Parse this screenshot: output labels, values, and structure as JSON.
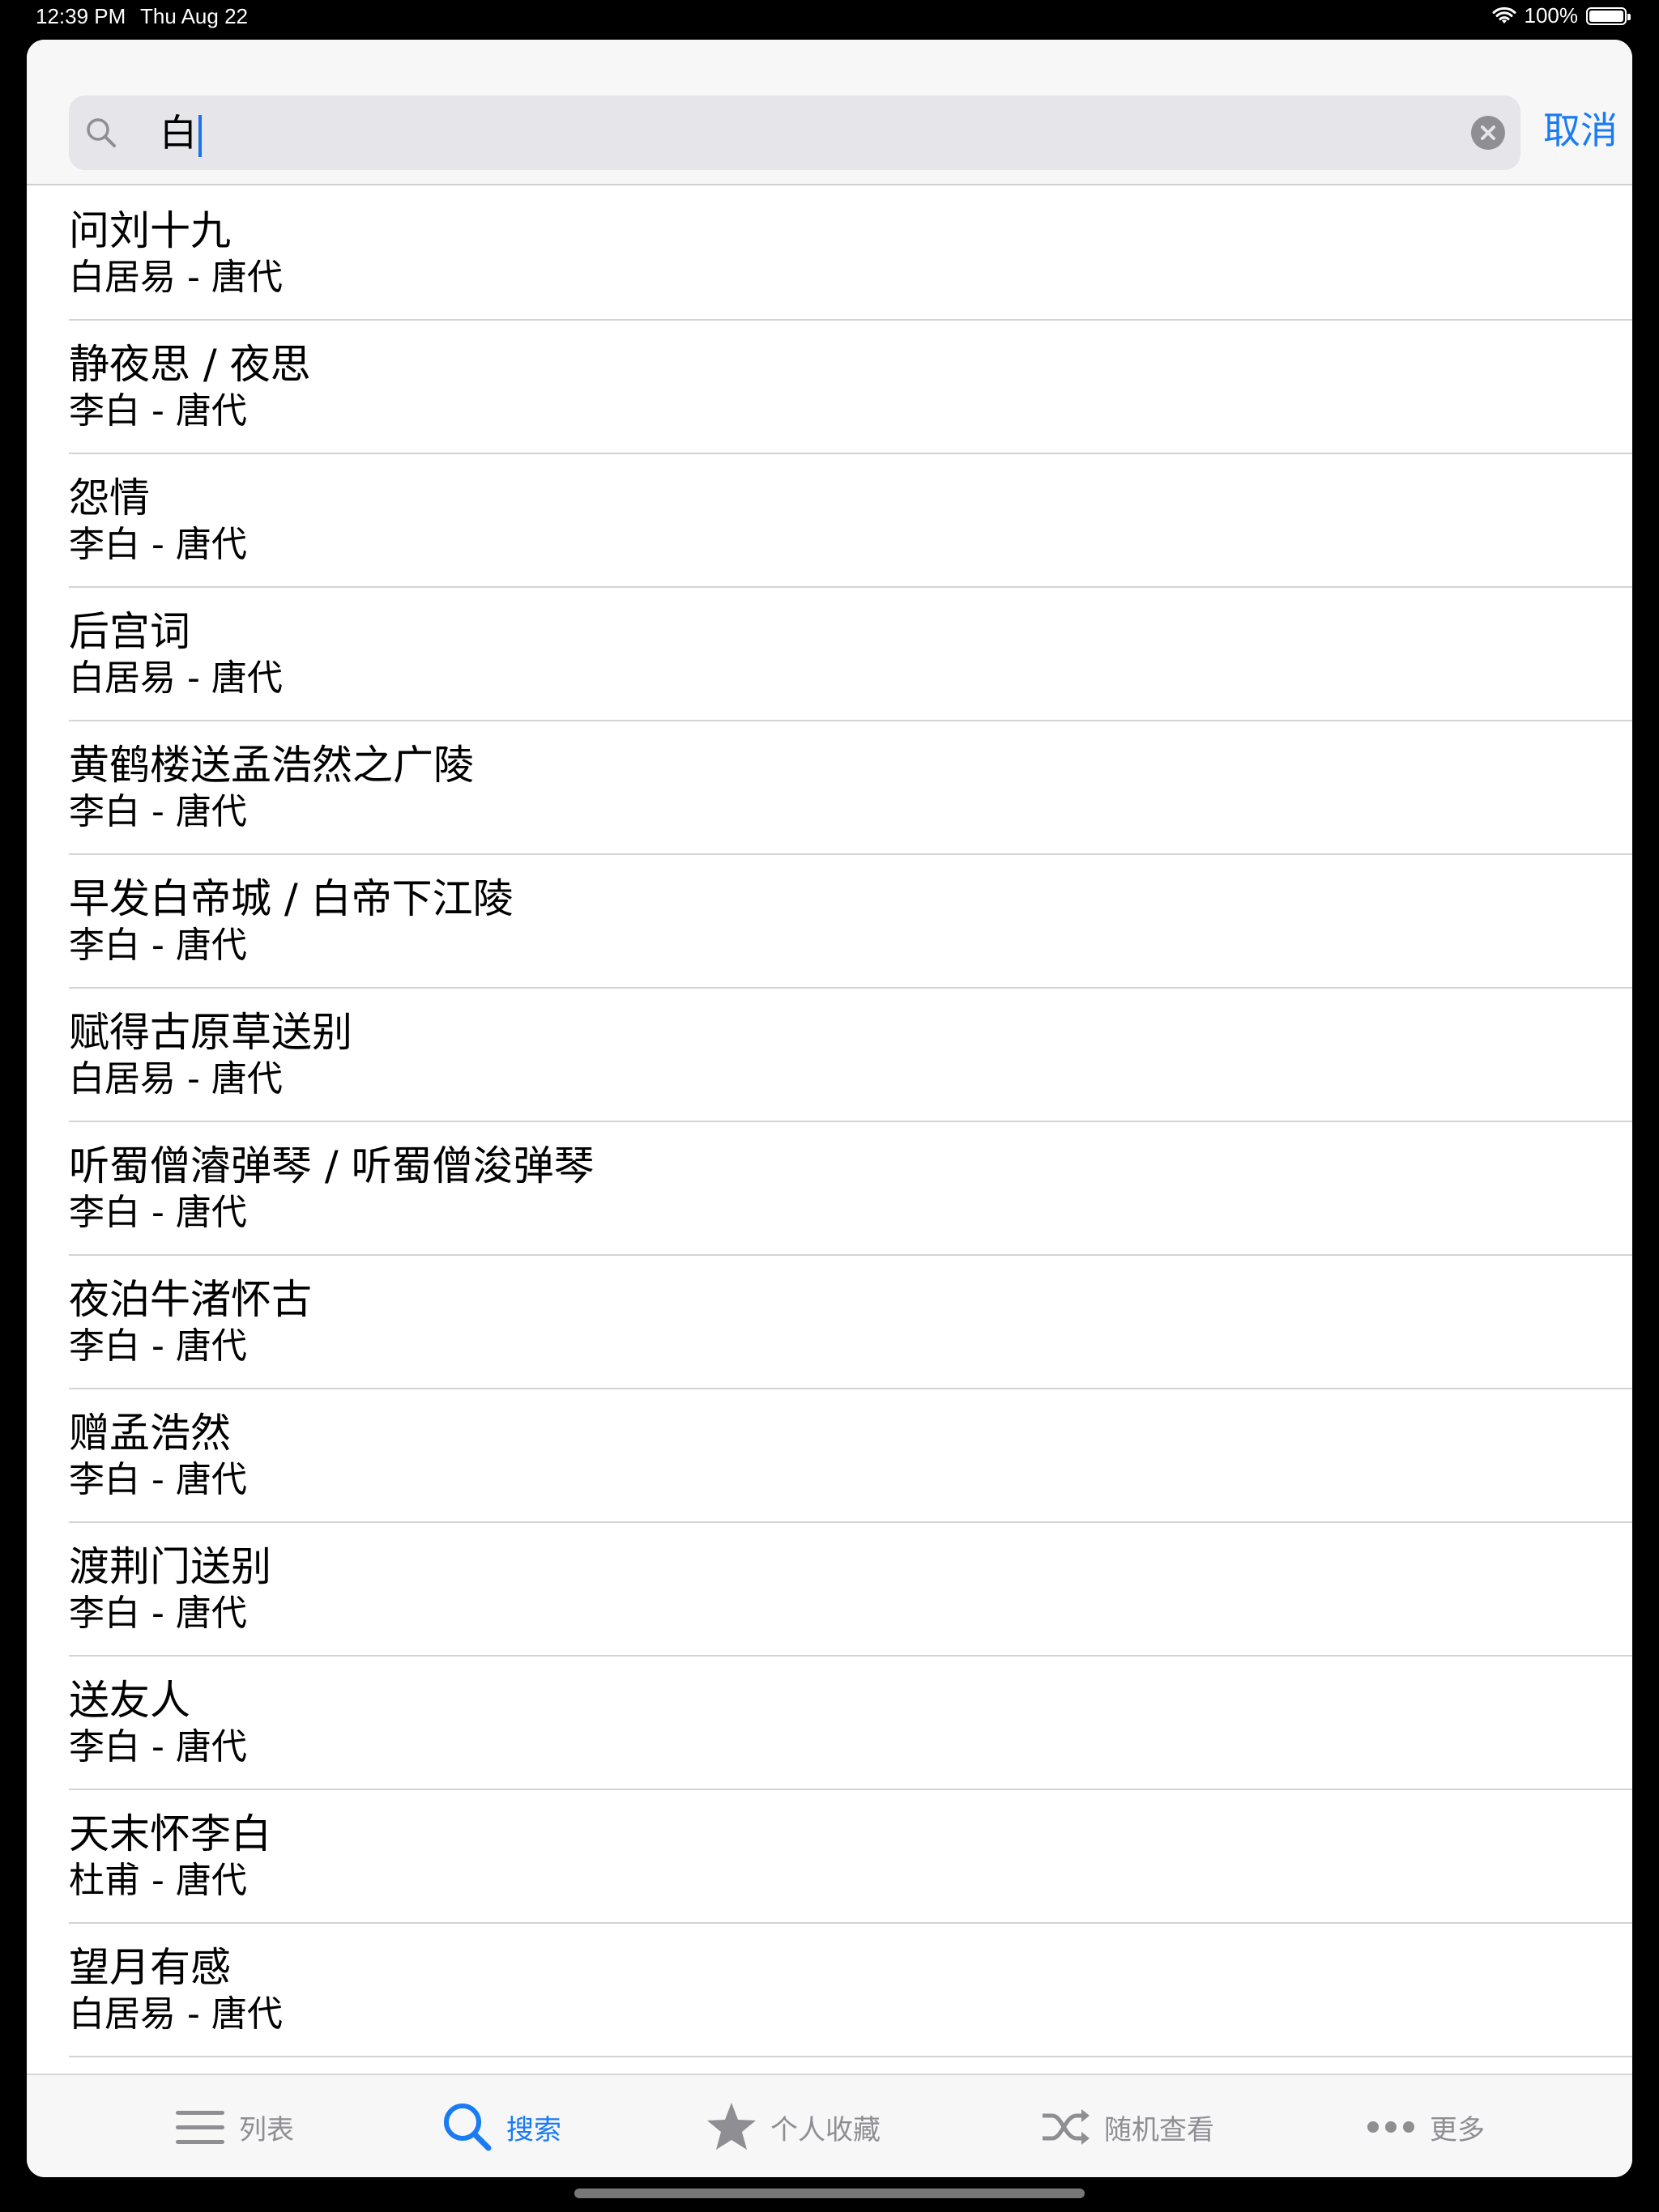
{
  "status_bar": {
    "time": "12:39 PM",
    "date": "Thu Aug 22",
    "battery": "100%",
    "battery_level": 1.0
  },
  "search": {
    "query": "白",
    "cancel_label": "取消"
  },
  "results": [
    {
      "title": "问刘十九",
      "subtitle": "白居易 - 唐代"
    },
    {
      "title": "静夜思 / 夜思",
      "subtitle": "李白 - 唐代"
    },
    {
      "title": "怨情",
      "subtitle": "李白 - 唐代"
    },
    {
      "title": "后宫词",
      "subtitle": "白居易 - 唐代"
    },
    {
      "title": "黄鹤楼送孟浩然之广陵",
      "subtitle": "李白 - 唐代"
    },
    {
      "title": "早发白帝城 / 白帝下江陵",
      "subtitle": "李白 - 唐代"
    },
    {
      "title": "赋得古原草送别",
      "subtitle": "白居易 - 唐代"
    },
    {
      "title": "听蜀僧濬弹琴 / 听蜀僧浚弹琴",
      "subtitle": "李白 - 唐代"
    },
    {
      "title": "夜泊牛渚怀古",
      "subtitle": "李白 - 唐代"
    },
    {
      "title": "赠孟浩然",
      "subtitle": "李白 - 唐代"
    },
    {
      "title": "渡荆门送别",
      "subtitle": "李白 - 唐代"
    },
    {
      "title": "送友人",
      "subtitle": "李白 - 唐代"
    },
    {
      "title": "天末怀李白",
      "subtitle": "杜甫 - 唐代"
    },
    {
      "title": "望月有感",
      "subtitle": "白居易 - 唐代"
    }
  ],
  "tabs": [
    {
      "label": "列表",
      "icon": "list-icon"
    },
    {
      "label": "搜索",
      "icon": "search-icon",
      "active": true
    },
    {
      "label": "个人收藏",
      "icon": "star-icon"
    },
    {
      "label": "随机查看",
      "icon": "shuffle-icon"
    },
    {
      "label": "更多",
      "icon": "more-icon"
    }
  ],
  "colors": {
    "accent": "#1a7bf2",
    "inactive": "#8e8e93"
  }
}
